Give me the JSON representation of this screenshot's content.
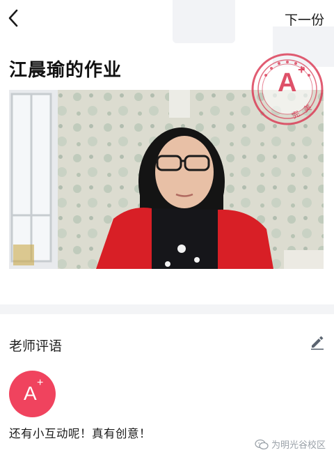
{
  "header": {
    "back_icon": "chevron-left-icon",
    "next_label": "下一份"
  },
  "homework": {
    "title": "江晨瑜的作业",
    "stamp": {
      "grade": "A",
      "plus": "+",
      "text": "完美",
      "color": "#d9334f"
    }
  },
  "review": {
    "section_title": "老师评语",
    "edit_icon": "pencil-icon",
    "grade": "A",
    "grade_plus": "+",
    "grade_color": "#f0435e",
    "comment": "还有小互动呢！真有创意！"
  },
  "watermark": {
    "icon": "wechat-icon",
    "text": "为明光谷校区"
  }
}
